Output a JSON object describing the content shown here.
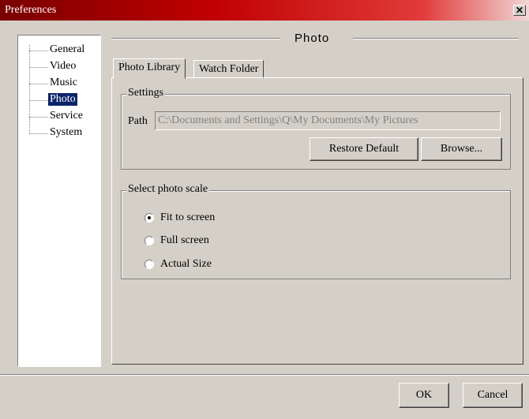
{
  "window": {
    "title": "Preferences",
    "close_glyph": "✕"
  },
  "tree": {
    "items": [
      {
        "label": "General"
      },
      {
        "label": "Video"
      },
      {
        "label": "Music"
      },
      {
        "label": "Photo",
        "selected": true
      },
      {
        "label": "Service"
      },
      {
        "label": "System"
      }
    ]
  },
  "section": {
    "title": "Photo"
  },
  "tabs": [
    {
      "label": "Photo Library",
      "active": true
    },
    {
      "label": "Watch Folder",
      "active": false
    }
  ],
  "settings": {
    "legend": "Settings",
    "path_label": "Path",
    "path_value": "C:\\Documents and Settings\\Q\\My Documents\\My Pictures",
    "restore_default_label": "Restore Default",
    "browse_label": "Browse..."
  },
  "photo_scale": {
    "legend": "Select photo scale",
    "options": [
      {
        "label": "Fit to screen",
        "checked": true
      },
      {
        "label": "Full screen",
        "checked": false
      },
      {
        "label": "Actual Size",
        "checked": false
      }
    ]
  },
  "footer": {
    "ok_label": "OK",
    "cancel_label": "Cancel"
  },
  "colors": {
    "titlebar_start": "#7a0000",
    "titlebar_end": "#f2d6d6",
    "selection": "#0a246a",
    "face": "#d4d0c8"
  }
}
